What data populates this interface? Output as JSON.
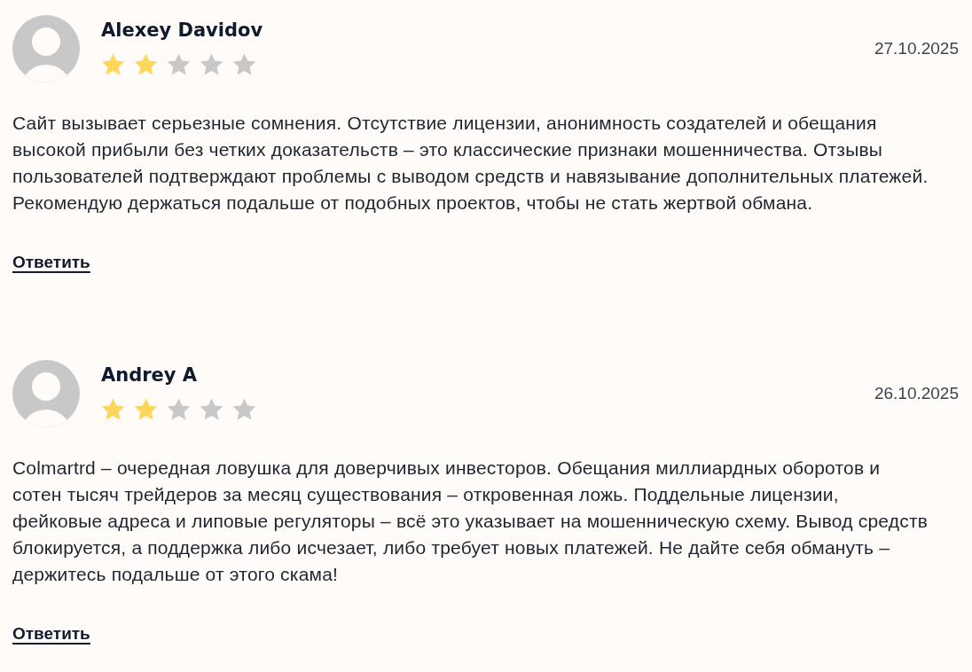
{
  "reviews": [
    {
      "author": "Alexey Davidov",
      "stars": 2,
      "date": "27.10.2025",
      "text": "Сайт вызывает серьезные сомнения. Отсутствие лицензии, анонимность создателей и обещания высокой прибыли без четких доказательств – это классические признаки мошенничества. Отзывы пользователей подтверждают проблемы с выводом средств и навязывание дополнительных платежей. Рекомендую держаться подальше от подобных проектов, чтобы не стать жертвой обмана.",
      "reply_link": "Ответить"
    },
    {
      "author": "Andrey A",
      "stars": 2,
      "date": "26.10.2025",
      "text": "Colmartrd – очередная ловушка для доверчивых инвесторов. Обещания миллиардных оборотов и сотен тысяч трейдеров за месяц существования – откровенная ложь. Поддельные лицензии, фейковые адреса и липовые регуляторы – всё это указывает на мошенническую схему. Вывод средств блокируется, а поддержка либо исчезает, либо требует новых платежей. Не дайте себя обмануть – держитесь подальше от этого скама!",
      "reply_link": "Ответить"
    }
  ]
}
